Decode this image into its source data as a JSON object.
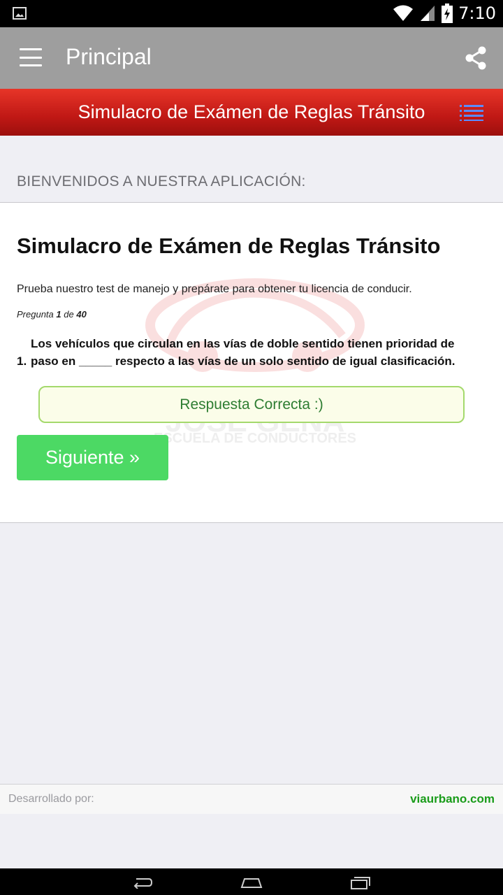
{
  "status_bar": {
    "time": "7:10",
    "icons": [
      "image-icon",
      "wifi-icon",
      "signal-icon",
      "battery-icon"
    ]
  },
  "action_bar": {
    "title": "Principal",
    "icons": [
      "menu-icon",
      "share-icon"
    ]
  },
  "banner": {
    "title": "Simulacro de Exámen de Reglas Tránsito",
    "icon": "list-icon"
  },
  "welcome": "BIENVENIDOS A NUESTRA APLICACIÓN:",
  "card": {
    "title": "Simulacro de Exámen de Reglas Tránsito",
    "description": "Prueba nuestro test de manejo y prepárate para obtener tu licencia de conducir.",
    "counter_prefix": "Pregunta",
    "counter_current": "1",
    "counter_of": "de",
    "counter_total": "40",
    "question_number": "1.",
    "question_text": "Los vehículos que circulan en las vías de doble sentido tienen prioridad de paso en _____ respecto a las vías de un solo sentido de igual clasificación.",
    "answer": "Respuesta Correcta :)",
    "next_label": "Siguiente »",
    "watermark_text1": "JOSE GENA",
    "watermark_text2": "ESCUELA DE CONDUCTORES"
  },
  "footer": {
    "label": "Desarrollado por:",
    "link": "viaurbano.com"
  },
  "colors": {
    "action_bar": "#9e9e9e",
    "banner": "#c01815",
    "answer_border": "#a4d96c",
    "next_button": "#4cd964",
    "footer_link": "#1a9c1a"
  }
}
